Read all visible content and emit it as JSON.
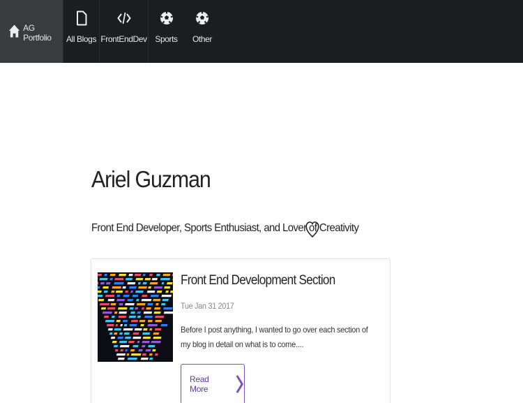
{
  "nav": {
    "brand": {
      "label": "AG Portfolio",
      "icon": "home-icon"
    },
    "items": [
      {
        "label": "All Blogs",
        "icon": "document-icon"
      },
      {
        "label": "FrontEndDev",
        "icon": "code-icon"
      },
      {
        "label": "Sports",
        "icon": "soccer-ball-icon"
      },
      {
        "label": "Other",
        "icon": "soccer-ball-icon"
      }
    ]
  },
  "header": {
    "title": "Ariel Guzman",
    "tagline": "Front End Developer, Sports Enthusiast, and Lover of Creativity",
    "tagline_icon": "heart-icon"
  },
  "posts": [
    {
      "title": "Front End Development Section",
      "date": "Tue Jan 31 2017",
      "excerpt": "Before I post anything, I wanted to go over each section of my blog in detail on what is to come....",
      "read_more_label": "Read More",
      "read_more_icon": "chevron-right-icon"
    }
  ],
  "colors": {
    "nav_bg": "#1c1d1f",
    "nav_brand_bg": "#3a3b3d",
    "accent": "#7b4cc4"
  }
}
